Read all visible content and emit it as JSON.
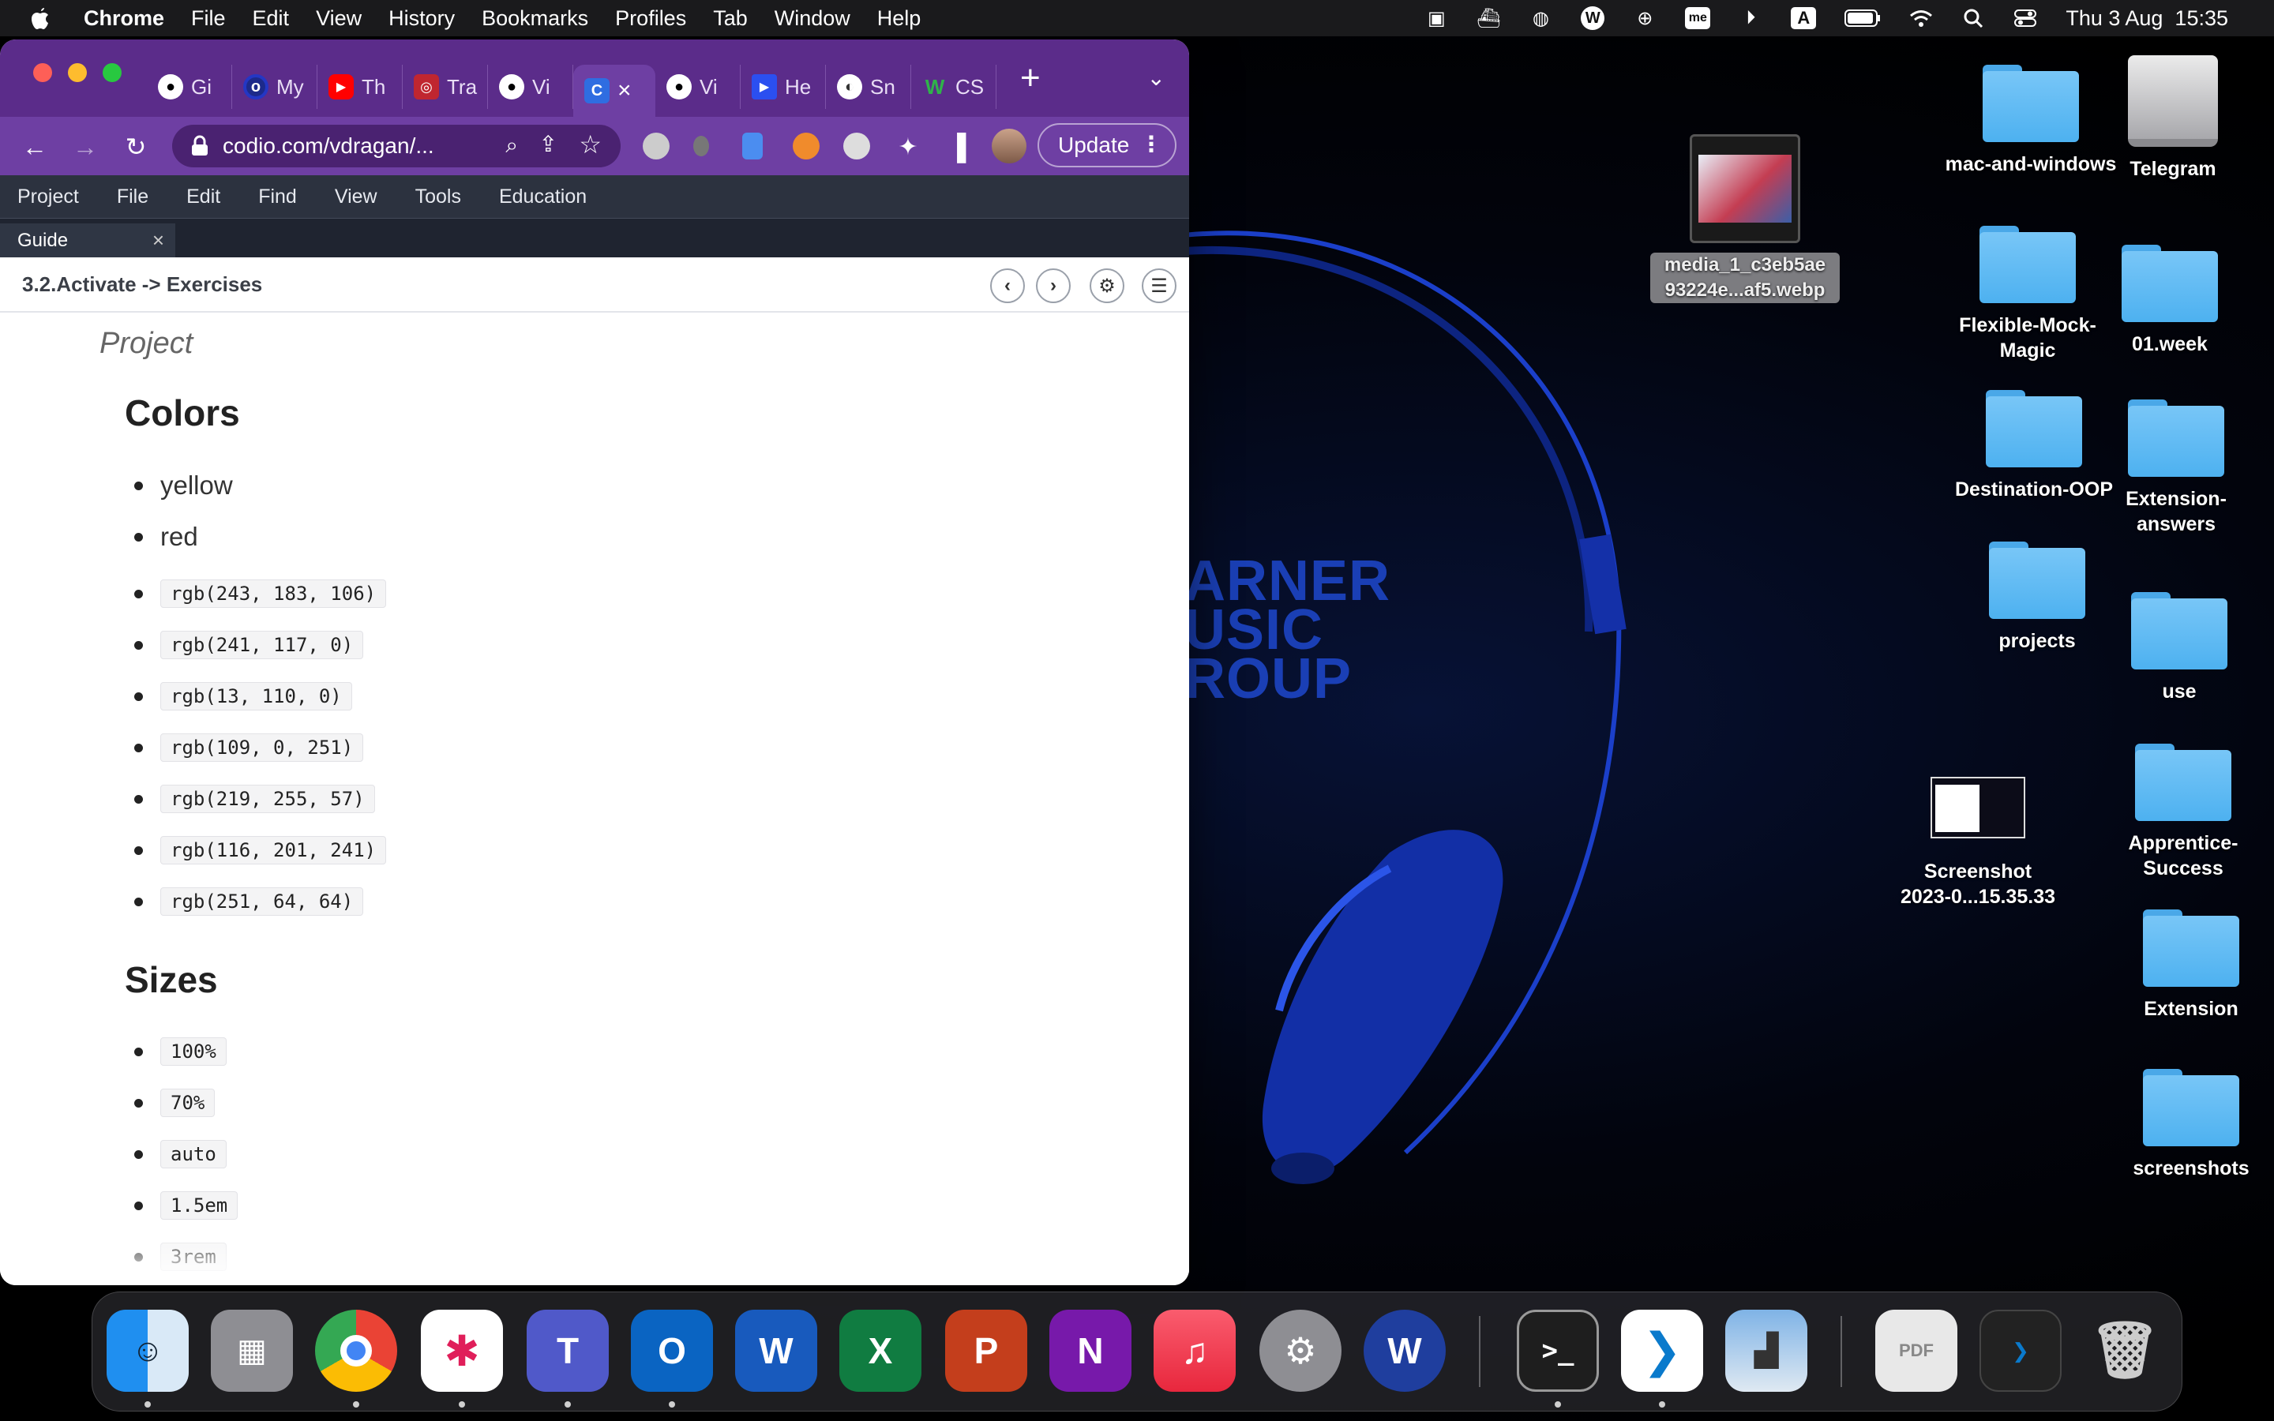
{
  "menubar": {
    "app": "Chrome",
    "items": [
      "File",
      "Edit",
      "View",
      "History",
      "Bookmarks",
      "Profiles",
      "Tab",
      "Window",
      "Help"
    ],
    "input_indicator": "A",
    "me_badge": "me",
    "clock": "Thu 3 Aug  15:35"
  },
  "browser": {
    "tabs": [
      {
        "label": "Gi",
        "icon": "github-icon"
      },
      {
        "label": "My",
        "icon": "circle-icon"
      },
      {
        "label": "Th",
        "icon": "youtube-icon"
      },
      {
        "label": "Tra",
        "icon": "app-icon"
      },
      {
        "label": "Vi",
        "icon": "github-icon"
      },
      {
        "label": "",
        "icon": "codio-icon",
        "active": true
      },
      {
        "label": "Vi",
        "icon": "github-icon"
      },
      {
        "label": "He",
        "icon": "play-icon"
      },
      {
        "label": "Sn",
        "icon": "globe-icon"
      },
      {
        "label": "CS",
        "icon": "w-icon"
      }
    ],
    "active_tab_close": "×",
    "url": "codio.com/vdragan/...",
    "update_label": "Update"
  },
  "codio": {
    "menu": [
      "Project",
      "File",
      "Edit",
      "Find",
      "View",
      "Tools",
      "Education"
    ],
    "guide_tab": "Guide",
    "guide_tab_close": "×",
    "breadcrumb": "3.2.Activate -> Exercises",
    "project_heading": "Project",
    "sections": [
      {
        "title": "Colors",
        "items": [
          {
            "text": "yellow",
            "code": false
          },
          {
            "text": "red",
            "code": false
          },
          {
            "text": "rgb(243, 183, 106)",
            "code": true
          },
          {
            "text": "rgb(241, 117, 0)",
            "code": true
          },
          {
            "text": "rgb(13, 110, 0)",
            "code": true
          },
          {
            "text": "rgb(109, 0, 251)",
            "code": true
          },
          {
            "text": "rgb(219, 255, 57)",
            "code": true
          },
          {
            "text": "rgb(116, 201, 241)",
            "code": true
          },
          {
            "text": "rgb(251, 64, 64)",
            "code": true
          }
        ]
      },
      {
        "title": "Sizes",
        "items": [
          {
            "text": "100%",
            "code": true
          },
          {
            "text": "70%",
            "code": true
          },
          {
            "text": "auto",
            "code": true
          },
          {
            "text": "1.5em",
            "code": true
          },
          {
            "text": "3rem",
            "code": true
          }
        ]
      }
    ]
  },
  "desktop": {
    "wallpaper_text": [
      "ARNER",
      "USIC",
      "ROUP"
    ],
    "icons": [
      {
        "label": "mac-and-windows",
        "kind": "folder"
      },
      {
        "label": "Telegram",
        "kind": "drive"
      },
      {
        "label": "media_1_c3eb5ae\n93224e...af5.webp",
        "kind": "image"
      },
      {
        "label": "Flexible-Mock-\nMagic",
        "kind": "folder"
      },
      {
        "label": "01.week",
        "kind": "folder"
      },
      {
        "label": "Destination-OOP",
        "kind": "folder"
      },
      {
        "label": "Extension-\nanswers",
        "kind": "folder"
      },
      {
        "label": "projects",
        "kind": "folder"
      },
      {
        "label": "use",
        "kind": "folder"
      },
      {
        "label": "Screenshot\n2023-0...15.35.33",
        "kind": "image"
      },
      {
        "label": "Apprentice-\nSuccess",
        "kind": "folder"
      },
      {
        "label": "Extension",
        "kind": "folder"
      },
      {
        "label": "screenshots",
        "kind": "folder"
      }
    ]
  },
  "dock": {
    "apps": [
      "Finder",
      "Launchpad",
      "Chrome",
      "Slack",
      "Teams",
      "Outlook",
      "Word",
      "Excel",
      "PowerPoint",
      "OneNote",
      "Music",
      "System Preferences",
      "Warner Music",
      "Terminal",
      "VS Code",
      "Preview",
      "Documents",
      "Recent",
      "Trash"
    ],
    "glyphs": {
      "teams": "T",
      "outlook": "O",
      "word": "W",
      "excel": "X",
      "powerpoint": "P",
      "onenote": "N",
      "warner": "W",
      "terminal": ">_",
      "pdf": "PDF"
    }
  },
  "colors": {
    "chrome_tabstrip": "#5b2c8a",
    "chrome_toolbar": "#6e3fa3",
    "codio_menu": "#2c323f",
    "folder": "#5ab8f2"
  }
}
